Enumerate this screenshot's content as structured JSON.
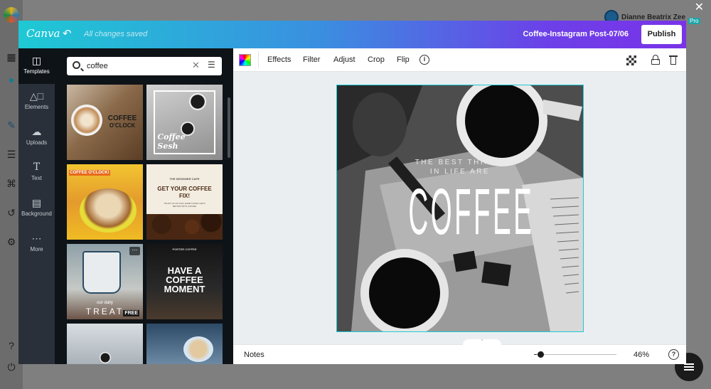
{
  "background": {
    "user_name": "Dianne Beatrix Zee",
    "pro_badge": "Pro"
  },
  "topbar": {
    "logo": "Canva",
    "save_status": "All changes saved",
    "doc_title": "Coffee-Instagram Post-07/06",
    "publish_label": "Publish",
    "gradient": [
      "#1ec9d4",
      "#6d3fe8"
    ]
  },
  "rail": {
    "items": [
      {
        "label": "Templates",
        "icon": "templates-icon"
      },
      {
        "label": "Elements",
        "icon": "elements-icon"
      },
      {
        "label": "Uploads",
        "icon": "uploads-icon"
      },
      {
        "label": "Text",
        "icon": "text-icon"
      },
      {
        "label": "Background",
        "icon": "background-icon"
      },
      {
        "label": "More",
        "icon": "more-icon"
      }
    ]
  },
  "search": {
    "value": "coffee",
    "placeholder": "Search"
  },
  "templates": [
    {
      "lines": [
        "COFFEE",
        "O'CLOCK"
      ]
    },
    {
      "lines": [
        "Coffee",
        "Sesh"
      ]
    },
    {
      "lines": [
        "COFFEE O'CLOCK!"
      ]
    },
    {
      "lines": [
        "THE DESIGNER CAFE",
        "GET YOUR COFFEE",
        "FIX!",
        "TRUST US ON THIS, EVERYTHING GETS",
        "BETTER WITH COFFEE"
      ]
    },
    {
      "lines": [
        "our daily",
        "TREAT"
      ],
      "badge": "FREE"
    },
    {
      "lines": [
        "PORTER COFFEE",
        "HAVE A",
        "COFFEE",
        "MOMENT"
      ]
    },
    {
      "lines": []
    },
    {
      "lines": []
    }
  ],
  "toolbar": {
    "effects": "Effects",
    "filter": "Filter",
    "adjust": "Adjust",
    "crop": "Crop",
    "flip": "Flip"
  },
  "design": {
    "tagline_1": "THE BEST THINGS",
    "tagline_2": "IN LIFE ARE",
    "headline": "COFFEE"
  },
  "footer": {
    "notes": "Notes",
    "zoom": "46%",
    "help": "?"
  }
}
